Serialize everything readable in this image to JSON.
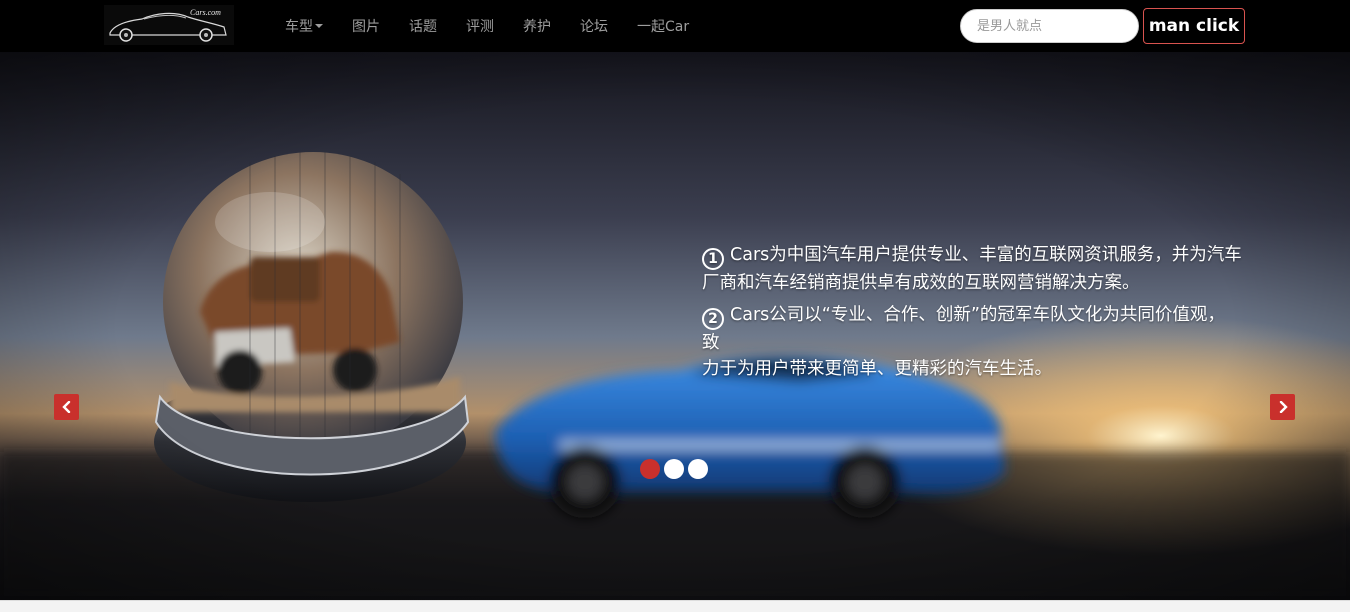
{
  "navbar": {
    "logo_text": "Cars.com",
    "links": [
      {
        "label": "车型",
        "dropdown": true
      },
      {
        "label": "图片"
      },
      {
        "label": "话题"
      },
      {
        "label": "评测"
      },
      {
        "label": "养护"
      },
      {
        "label": "论坛"
      },
      {
        "label": "一起Car"
      }
    ],
    "search": {
      "placeholder": "是男人就点",
      "value": ""
    },
    "button_label": "man click"
  },
  "carousel": {
    "caption": {
      "items": [
        {
          "number": "1",
          "text": "Cars为中国汽车用户提供专业、丰富的互联网资讯服务，并为汽车厂商和汽车经销商提供卓有成效的互联网营销解决方案。"
        },
        {
          "number": "2",
          "text": "Cars公司以“专业、合作、创新”的冠军车队文化为共同价值观，致",
          "text_cont": "力于为用户带来更简单、更精彩的汽车生活。"
        }
      ]
    },
    "indicators": {
      "count": 3,
      "active_index": 0
    },
    "controls": {
      "prev_icon": "chevron-left-icon",
      "next_icon": "chevron-right-icon"
    }
  },
  "colors": {
    "navbar_bg": "#000000",
    "nav_link": "#9d9d9d",
    "accent_red": "#c9302c",
    "button_border": "#d9534f",
    "car_blue": "#1f6fc4"
  }
}
